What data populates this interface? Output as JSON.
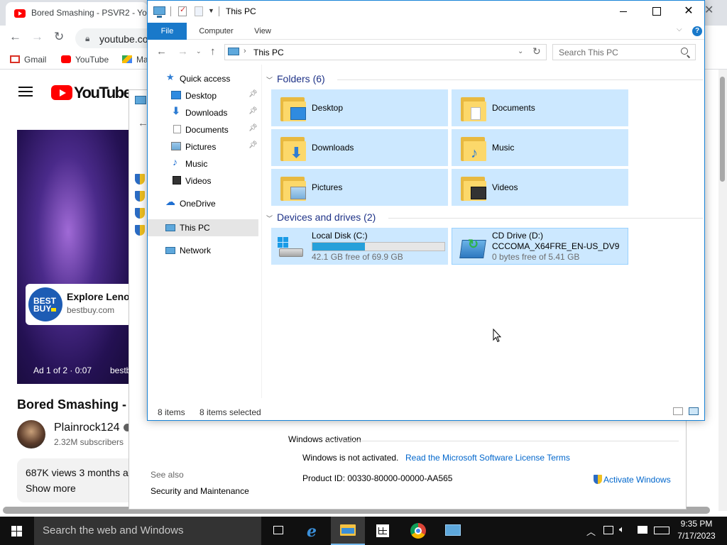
{
  "browser": {
    "tab_title": "Bored Smashing - PSVR2 - Yo",
    "close_icon": "close-icon",
    "omnibox_text": "youtube.co",
    "bookmarks": [
      {
        "label": "Gmail",
        "icon": "gmail-icon"
      },
      {
        "label": "YouTube",
        "icon": "youtube-icon"
      },
      {
        "label": "Ma",
        "icon": "maps-icon"
      }
    ]
  },
  "youtube": {
    "logo_text": "YouTube",
    "ad": {
      "brand_badge": "BEST BUY",
      "title": "Explore Lenov",
      "url": "bestbuy.com",
      "counter": "Ad 1 of 2 · 0:07",
      "counter_trailing": "bestb"
    },
    "video_title": "Bored Smashing - P",
    "channel_name": "Plainrock124",
    "subscribers": "2.32M subscribers",
    "views": "687K views  3 months a",
    "show_more": "Show more"
  },
  "system_window": {
    "activation_heading": "Windows activation",
    "activation_status": "Windows is not activated.",
    "license_link": "Read the Microsoft Software License Terms",
    "product_id": "Product ID:  00330-80000-00000-AA565",
    "see_also": "See also",
    "security_link": "Security and Maintenance",
    "activate_link": "Activate Windows"
  },
  "explorer": {
    "title": "This PC",
    "ribbon_tabs": [
      "File",
      "Computer",
      "View"
    ],
    "address": "This PC",
    "search_placeholder": "Search This PC",
    "nav_pane": {
      "quick_access": "Quick access",
      "pinned": [
        {
          "label": "Desktop",
          "pinned": true
        },
        {
          "label": "Downloads",
          "pinned": true
        },
        {
          "label": "Documents",
          "pinned": true
        },
        {
          "label": "Pictures",
          "pinned": true
        },
        {
          "label": "Music",
          "pinned": false
        },
        {
          "label": "Videos",
          "pinned": false
        }
      ],
      "onedrive": "OneDrive",
      "this_pc": "This PC",
      "network": "Network"
    },
    "folders_heading": "Folders (6)",
    "folders": [
      "Desktop",
      "Documents",
      "Downloads",
      "Music",
      "Pictures",
      "Videos"
    ],
    "drives_heading": "Devices and drives (2)",
    "drives": [
      {
        "name": "Local Disk (C:)",
        "free": "42.1 GB free of 69.9 GB",
        "used_fraction": 0.398
      },
      {
        "name": "CD Drive (D:)",
        "label": "CCCOMA_X64FRE_EN-US_DV9",
        "free": "0 bytes free of 5.41 GB"
      }
    ],
    "status_count": "8 items",
    "status_selected": "8 items selected"
  },
  "taskbar": {
    "search_placeholder": "Search the web and Windows",
    "clock_time": "9:35 PM",
    "clock_date": "7/17/2023"
  },
  "colors": {
    "selection_blue": "#cce8ff",
    "file_tab_blue": "#1979ca",
    "group_heading_blue": "#1e3287",
    "link_blue": "#0066cc",
    "taskbar_dark": "#101010"
  }
}
